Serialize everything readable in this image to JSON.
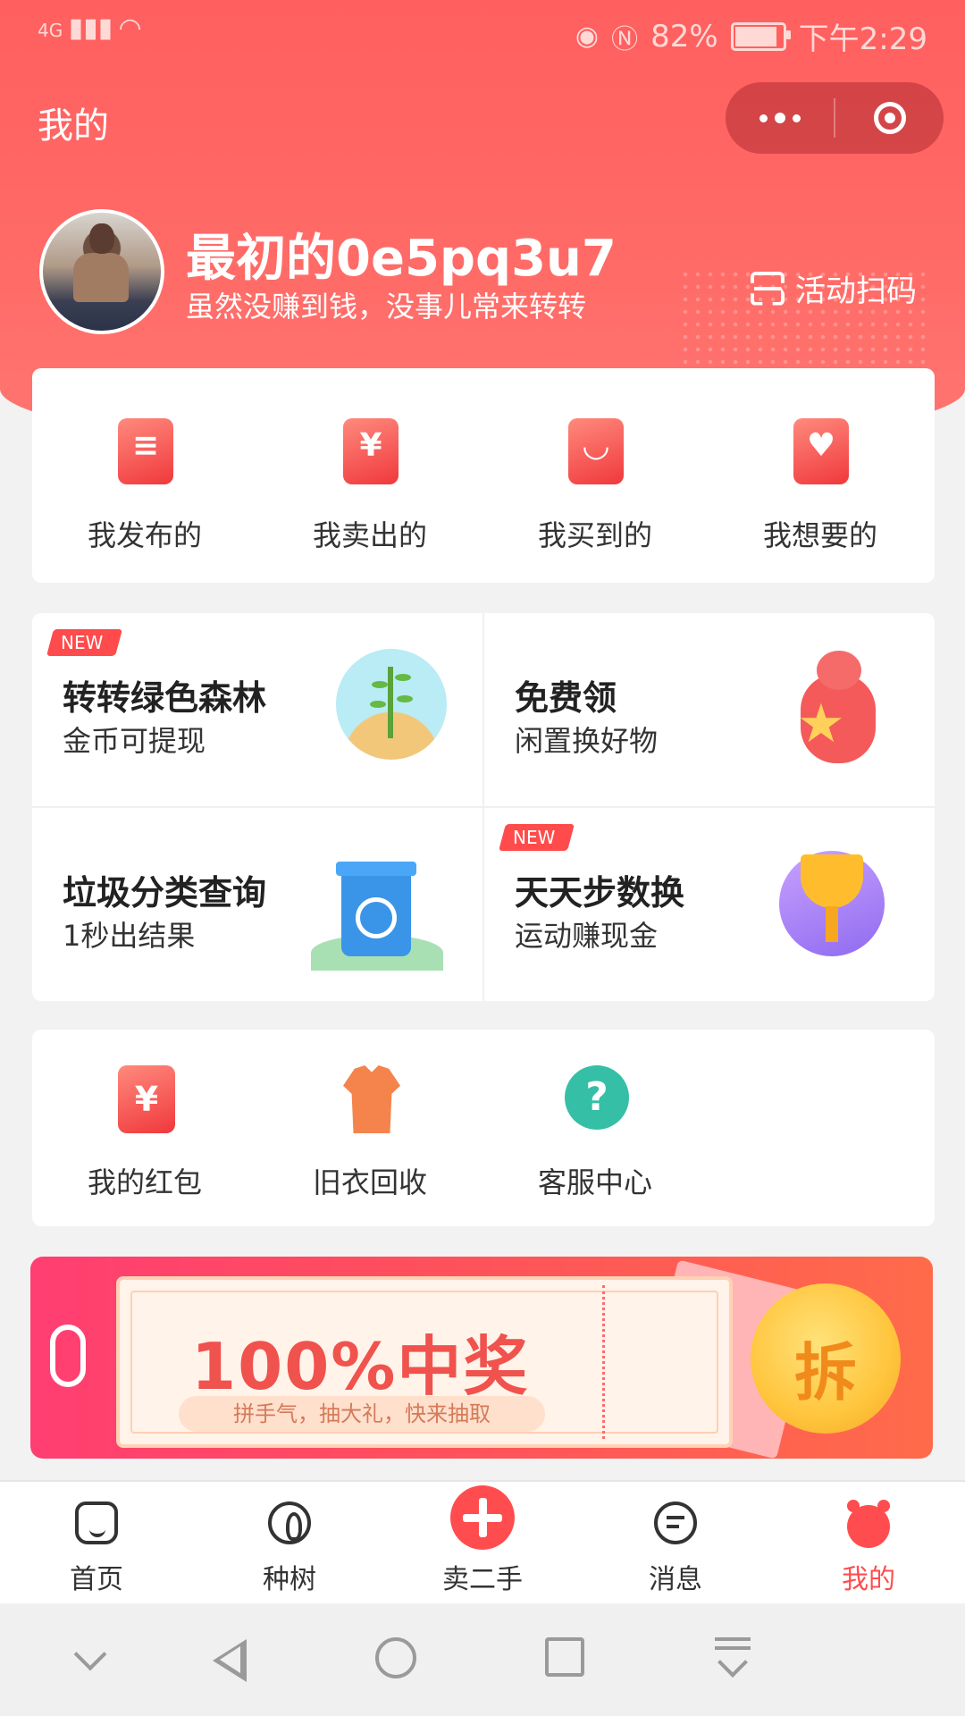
{
  "status_bar": {
    "network": "4G",
    "battery": "82%",
    "time": "下午2:29",
    "battery_level": 0.82,
    "icons": [
      "signal-icon",
      "wifi-icon",
      "eye-icon",
      "nfc-icon",
      "battery-icon"
    ]
  },
  "header": {
    "title": "我的",
    "more_icon": "more-dots-icon",
    "close_icon": "target-icon"
  },
  "profile": {
    "username": "最初的0e5pq3u7",
    "tagline": "虽然没赚到钱，没事儿常来转转",
    "scan_label": "活动扫码",
    "scan_icon": "scan-icon"
  },
  "orders": [
    {
      "label": "我发布的",
      "icon": "publish-icon"
    },
    {
      "label": "我卖出的",
      "icon": "sold-yuan-icon"
    },
    {
      "label": "我买到的",
      "icon": "shopping-bag-icon"
    },
    {
      "label": "我想要的",
      "icon": "heart-icon"
    }
  ],
  "features": [
    {
      "title": "转转绿色森林",
      "subtitle": "金币可提现",
      "badge": "NEW",
      "icon": "tree-illustration"
    },
    {
      "title": "免费领",
      "subtitle": "闲置换好物",
      "badge": "",
      "icon": "bear-illustration"
    },
    {
      "title": "垃圾分类查询",
      "subtitle": "1秒出结果",
      "badge": "",
      "icon": "recycle-bin-illustration"
    },
    {
      "title": "天天步数换",
      "subtitle": "运动赚现金",
      "badge": "NEW",
      "icon": "trophy-illustration"
    }
  ],
  "services": [
    {
      "label": "我的红包",
      "icon": "red-packet-icon"
    },
    {
      "label": "旧衣回收",
      "icon": "shirt-icon"
    },
    {
      "label": "客服中心",
      "icon": "help-chat-icon"
    }
  ],
  "banner": {
    "headline": "100%中奖",
    "subline": "拼手气，抽大礼，快来抽取",
    "coin_text": "拆"
  },
  "tabbar": [
    {
      "label": "首页",
      "icon": "home-icon",
      "active": false
    },
    {
      "label": "种树",
      "icon": "sprout-icon",
      "active": false
    },
    {
      "label": "卖二手",
      "icon": "plus-icon",
      "active": false
    },
    {
      "label": "消息",
      "icon": "message-icon",
      "active": false
    },
    {
      "label": "我的",
      "icon": "bear-icon",
      "active": true
    }
  ],
  "colors": {
    "brand": "#ff5f5f",
    "active_tab": "#ff4d4f"
  }
}
